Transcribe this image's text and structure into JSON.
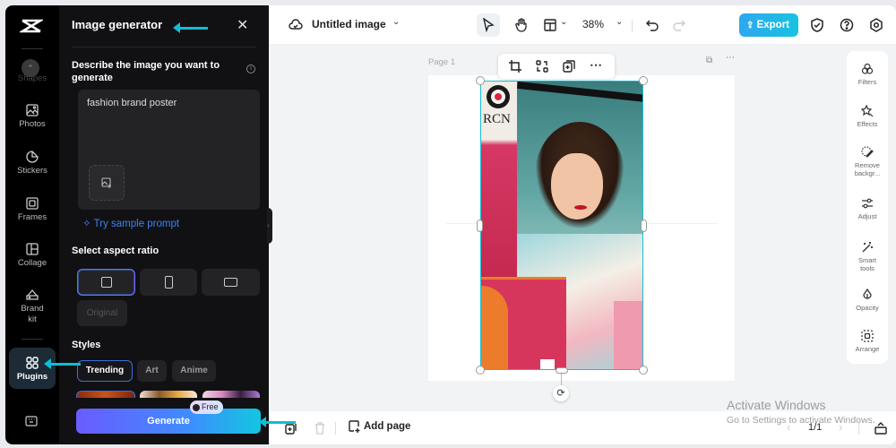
{
  "sidebar": {
    "items": [
      {
        "label": "Shapes",
        "icon": "shapes-icon"
      },
      {
        "label": "Photos",
        "icon": "image-icon"
      },
      {
        "label": "Stickers",
        "icon": "sticker-icon"
      },
      {
        "label": "Frames",
        "icon": "frame-icon"
      },
      {
        "label": "Collage",
        "icon": "collage-icon"
      },
      {
        "label": "Brand kit",
        "icon": "brand-kit-icon"
      },
      {
        "label": "Plugins",
        "icon": "grid-icon",
        "active": true
      }
    ]
  },
  "panel": {
    "title": "Image generator",
    "prompt_label": "Describe the image you want to generate",
    "prompt_value": "fashion brand poster",
    "sample_prompt": "Try sample prompt",
    "aspect_label": "Select aspect ratio",
    "aspect_options": [
      {
        "name": "square",
        "selected": true
      },
      {
        "name": "portrait",
        "selected": false
      },
      {
        "name": "landscape",
        "selected": false
      },
      {
        "name": "Original",
        "selected": false,
        "disabled": true
      }
    ],
    "original_label": "Original",
    "styles_label": "Styles",
    "styles": [
      {
        "label": "Trending",
        "selected": true
      },
      {
        "label": "Art",
        "selected": false
      },
      {
        "label": "Anime",
        "selected": false
      }
    ],
    "generate_label": "Generate",
    "free_badge": "Free"
  },
  "topbar": {
    "doc_title": "Untitled image",
    "zoom": "38%",
    "export_label": "Export"
  },
  "canvas": {
    "page_label": "Page 1",
    "poster_text": "RCN"
  },
  "right_tools": [
    {
      "label": "Filters"
    },
    {
      "label": "Effects"
    },
    {
      "label": "Remove backgr..."
    },
    {
      "label": "Adjust"
    },
    {
      "label": "Smart tools"
    },
    {
      "label": "Opacity"
    },
    {
      "label": "Arrange"
    }
  ],
  "bottombar": {
    "add_page": "Add page",
    "pager": "1/1"
  },
  "watermark": {
    "line1": "Activate Windows",
    "line2": "Go to Settings to activate Windows."
  },
  "colors": {
    "accent": "#14c0d4",
    "export_gradient_start": "#2ea7ee",
    "generate_gradient_start": "#6a5cff",
    "generate_gradient_end": "#13c6e0",
    "sample_link": "#3b82f6"
  }
}
